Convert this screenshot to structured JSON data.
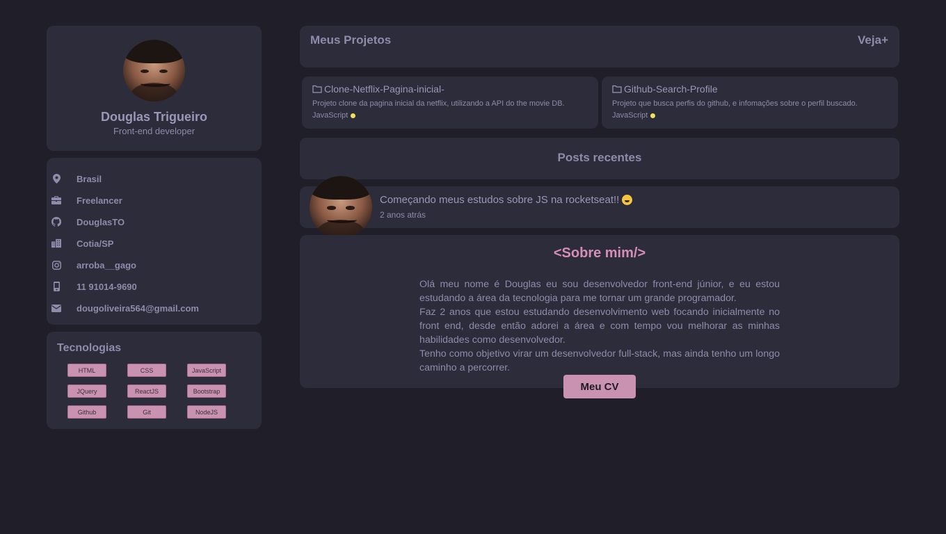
{
  "profile": {
    "name": "Douglas Trigueiro",
    "role": "Front-end developer"
  },
  "info": [
    {
      "icon": "location-pin-icon",
      "text": "Brasil"
    },
    {
      "icon": "briefcase-icon",
      "text": "Freelancer"
    },
    {
      "icon": "github-icon",
      "text": "DouglasTO"
    },
    {
      "icon": "buildings-icon",
      "text": "Cotia/SP"
    },
    {
      "icon": "instagram-icon",
      "text": "arroba__gago"
    },
    {
      "icon": "phone-icon",
      "text": "11 91014-9690"
    },
    {
      "icon": "envelope-icon",
      "text": "dougoliveira564@gmail.com"
    }
  ],
  "technologies": {
    "title": "Tecnologias",
    "tags": [
      "HTML",
      "CSS",
      "JavaScript",
      "JQuery",
      "ReactJS",
      "Bootstrap",
      "Github",
      "Git",
      "NodeJS"
    ]
  },
  "projects": {
    "title": "Meus Projetos",
    "more_label": "Veja+",
    "items": [
      {
        "name": "Clone-Netflix-Pagina-inicial-",
        "description": "Projeto clone da pagina inicial da netflix, utilizando a API do the movie DB.",
        "language": "JavaScript",
        "language_color": "#f1e05a"
      },
      {
        "name": "Github-Search-Profile",
        "description": "Projeto que busca perfis do github, e infomações sobre o perfil buscado.",
        "language": "JavaScript",
        "language_color": "#f1e05a"
      }
    ]
  },
  "posts": {
    "title": "Posts recentes",
    "items": [
      {
        "text": "Começando meus estudos sobre JS na rocketseat!!",
        "time": "2 anos atrás"
      }
    ]
  },
  "about": {
    "title": "<Sobre mim/>",
    "paragraphs": [
      "Olá meu nome é Douglas eu sou desenvolvedor front-end júnior, e eu estou estudando a área da tecnologia para me tornar um grande programador.",
      "Faz 2 anos que estou estudando desenvolvimento web focando inicialmente no front end, desde então adorei a área e com tempo vou melhorar as minhas habilidades como desenvolvedor.",
      "Tenho como objetivo virar um desenvolvedor full-stack, mas ainda tenho um longo caminho a percorrer."
    ],
    "cv_button": "Meu CV"
  },
  "colors": {
    "background": "#201f29",
    "card": "#2d2c3a",
    "accent": "#c992b1",
    "about_title": "#d58fb6"
  }
}
